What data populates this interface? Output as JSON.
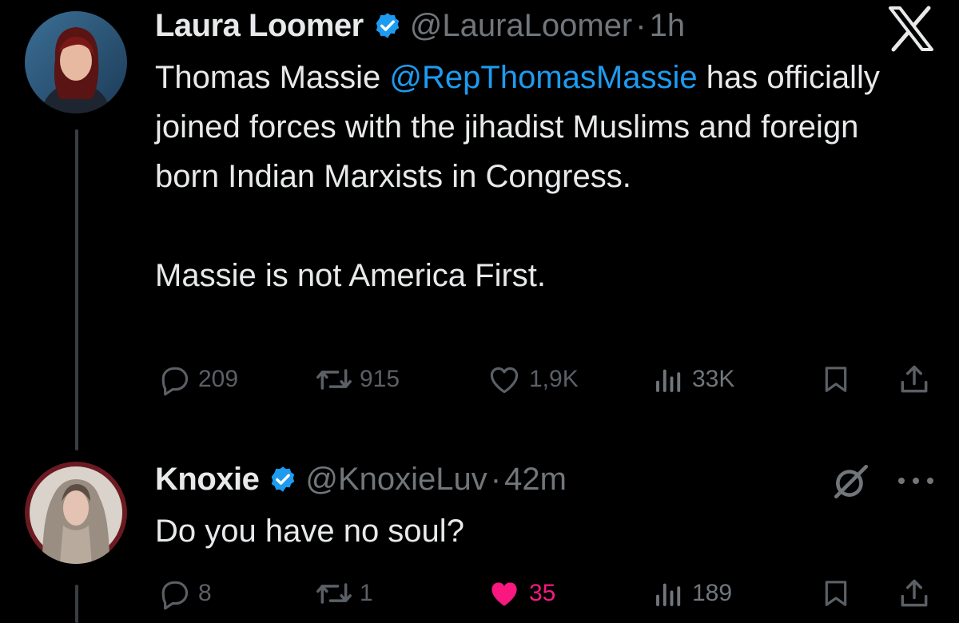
{
  "tweet": {
    "display_name": "Laura Loomer",
    "handle": "@LauraLoomer",
    "separator": "·",
    "time": "1h",
    "text_before_mention": "Thomas Massie ",
    "mention": "@RepThomasMassie",
    "text_after_mention": " has officially joined forces with the jihadist Muslims and foreign born Indian Marxists in Congress.\n\nMassie is not America First.",
    "stats": {
      "replies": "209",
      "reposts": "915",
      "likes": "1,9K",
      "views": "33K"
    },
    "icons": {
      "reply": "reply-icon",
      "repost": "repost-icon",
      "like": "heart-icon",
      "views": "views-icon",
      "bookmark": "bookmark-icon",
      "share": "share-icon",
      "verified": "verified-badge-icon",
      "logo": "x-logo-icon"
    }
  },
  "reply": {
    "display_name": "Knoxie",
    "handle": "@KnoxieLuv",
    "separator": "·",
    "time": "42m",
    "text": "Do you have no soul?",
    "stats": {
      "replies": "8",
      "reposts": "1",
      "likes": "35",
      "views": "189"
    },
    "liked": true,
    "icons": {
      "grok": "grok-icon",
      "more": "more-icon"
    }
  },
  "colors": {
    "background": "#000000",
    "text": "#e7e9ea",
    "secondary": "#71767b",
    "mention": "#1d9bf0",
    "verified": "#1d9bf0",
    "liked": "#f91880",
    "avatar_ring_reply": "#6b1a22"
  }
}
